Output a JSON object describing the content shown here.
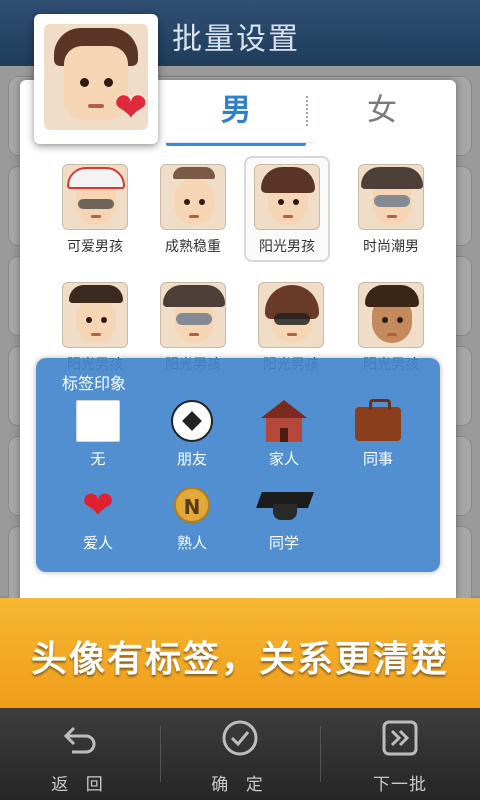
{
  "header": {
    "title": "批量设置"
  },
  "tabs": [
    {
      "label": "男",
      "active": true
    },
    {
      "label": "女",
      "active": false
    }
  ],
  "avatars": [
    {
      "label": "可爱男孩",
      "style": "cap"
    },
    {
      "label": "成熟稳重",
      "style": "bald"
    },
    {
      "label": "阳光男孩",
      "style": "plain",
      "selected": true
    },
    {
      "label": "时尚潮男",
      "style": "hat-glasses"
    },
    {
      "label": "阳光男孩",
      "style": "short"
    },
    {
      "label": "阳光男孩",
      "style": "hat-glasses"
    },
    {
      "label": "阳光男孩",
      "style": "glasses"
    },
    {
      "label": "阳光男孩",
      "style": "braids"
    }
  ],
  "tag_popup": {
    "title": "标签印象",
    "tags": [
      {
        "label": "无",
        "icon": "blank-icon"
      },
      {
        "label": "朋友",
        "icon": "soccer-ball-icon"
      },
      {
        "label": "家人",
        "icon": "house-icon"
      },
      {
        "label": "同事",
        "icon": "briefcase-icon"
      },
      {
        "label": "爱人",
        "icon": "heart-icon"
      },
      {
        "label": "熟人",
        "icon": "medal-icon",
        "glyph": "N"
      },
      {
        "label": "同学",
        "icon": "graduation-cap-icon"
      }
    ]
  },
  "banner": {
    "text": "头像有标签，关系更清楚"
  },
  "bottom_bar": [
    {
      "label": "返 回",
      "icon": "back-icon"
    },
    {
      "label": "确 定",
      "icon": "check-icon"
    },
    {
      "label": "下一批",
      "icon": "next-icon"
    }
  ],
  "colors": {
    "accent": "#2f7fca",
    "banner": "#f4a623",
    "popup": "#4286cd"
  }
}
